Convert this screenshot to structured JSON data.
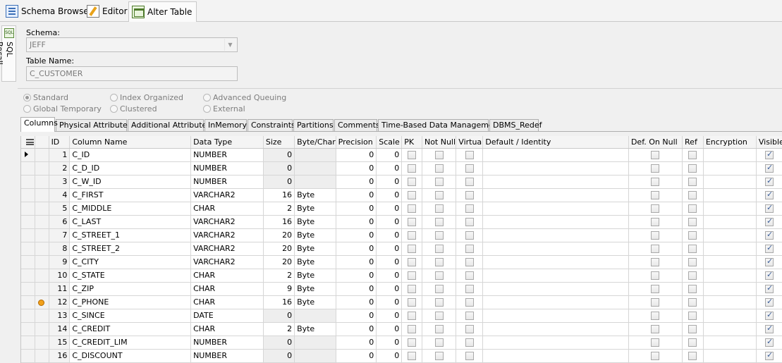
{
  "tabs": [
    {
      "label": "Schema Browser"
    },
    {
      "label": "Editor"
    },
    {
      "label": "Alter Table"
    }
  ],
  "side_tab": {
    "label": "SQL Recall",
    "icon_text": "SQL"
  },
  "form": {
    "schema_label": "Schema:",
    "schema_value": "JEFF",
    "table_label": "Table Name:",
    "table_value": "C_CUSTOMER"
  },
  "table_types": {
    "standard": "Standard",
    "global_temporary": "Global Temporary",
    "index_organized": "Index Organized",
    "clustered": "Clustered",
    "advanced_queuing": "Advanced Queuing",
    "external": "External",
    "selected": "Standard"
  },
  "inner_tabs": [
    "Columns",
    "Physical Attributes",
    "Additional Attributes",
    "InMemory",
    "Constraints",
    "Partitions",
    "Comments",
    "Time-Based Data Management",
    "DBMS_Redef"
  ],
  "grid": {
    "headers": {
      "id": "ID",
      "name": "Column Name",
      "type": "Data Type",
      "size": "Size",
      "bytechar": "Byte/Char",
      "precision": "Precision",
      "scale": "Scale",
      "pk": "PK",
      "notnull": "Not Null",
      "virtual": "Virtual",
      "default": "Default / Identity",
      "defnull": "Def. On Null",
      "ref": "Ref",
      "encryption": "Encryption",
      "visible": "Visible"
    },
    "rows": [
      {
        "id": "1",
        "name": "C_ID",
        "type": "NUMBER",
        "size": "0",
        "bytechar": "",
        "precision": "0",
        "scale": "0"
      },
      {
        "id": "2",
        "name": "C_D_ID",
        "type": "NUMBER",
        "size": "0",
        "bytechar": "",
        "precision": "0",
        "scale": "0"
      },
      {
        "id": "3",
        "name": "C_W_ID",
        "type": "NUMBER",
        "size": "0",
        "bytechar": "",
        "precision": "0",
        "scale": "0"
      },
      {
        "id": "4",
        "name": "C_FIRST",
        "type": "VARCHAR2",
        "size": "16",
        "bytechar": "Byte",
        "precision": "0",
        "scale": "0"
      },
      {
        "id": "5",
        "name": "C_MIDDLE",
        "type": "CHAR",
        "size": "2",
        "bytechar": "Byte",
        "precision": "0",
        "scale": "0"
      },
      {
        "id": "6",
        "name": "C_LAST",
        "type": "VARCHAR2",
        "size": "16",
        "bytechar": "Byte",
        "precision": "0",
        "scale": "0"
      },
      {
        "id": "7",
        "name": "C_STREET_1",
        "type": "VARCHAR2",
        "size": "20",
        "bytechar": "Byte",
        "precision": "0",
        "scale": "0"
      },
      {
        "id": "8",
        "name": "C_STREET_2",
        "type": "VARCHAR2",
        "size": "20",
        "bytechar": "Byte",
        "precision": "0",
        "scale": "0"
      },
      {
        "id": "9",
        "name": "C_CITY",
        "type": "VARCHAR2",
        "size": "20",
        "bytechar": "Byte",
        "precision": "0",
        "scale": "0"
      },
      {
        "id": "10",
        "name": "C_STATE",
        "type": "CHAR",
        "size": "2",
        "bytechar": "Byte",
        "precision": "0",
        "scale": "0"
      },
      {
        "id": "11",
        "name": "C_ZIP",
        "type": "CHAR",
        "size": "9",
        "bytechar": "Byte",
        "precision": "0",
        "scale": "0"
      },
      {
        "id": "12",
        "name": "C_PHONE",
        "type": "CHAR",
        "size": "16",
        "bytechar": "Byte",
        "precision": "0",
        "scale": "0"
      },
      {
        "id": "13",
        "name": "C_SINCE",
        "type": "DATE",
        "size": "0",
        "bytechar": "",
        "precision": "0",
        "scale": "0"
      },
      {
        "id": "14",
        "name": "C_CREDIT",
        "type": "CHAR",
        "size": "2",
        "bytechar": "Byte",
        "precision": "0",
        "scale": "0"
      },
      {
        "id": "15",
        "name": "C_CREDIT_LIM",
        "type": "NUMBER",
        "size": "0",
        "bytechar": "",
        "precision": "0",
        "scale": "0"
      },
      {
        "id": "16",
        "name": "C_DISCOUNT",
        "type": "NUMBER",
        "size": "0",
        "bytechar": "",
        "precision": "0",
        "scale": "0"
      }
    ]
  },
  "icons": {
    "current_row": "current-row-arrow-icon",
    "marker": "pk-marker-icon",
    "menu": "grid-menu-icon"
  }
}
